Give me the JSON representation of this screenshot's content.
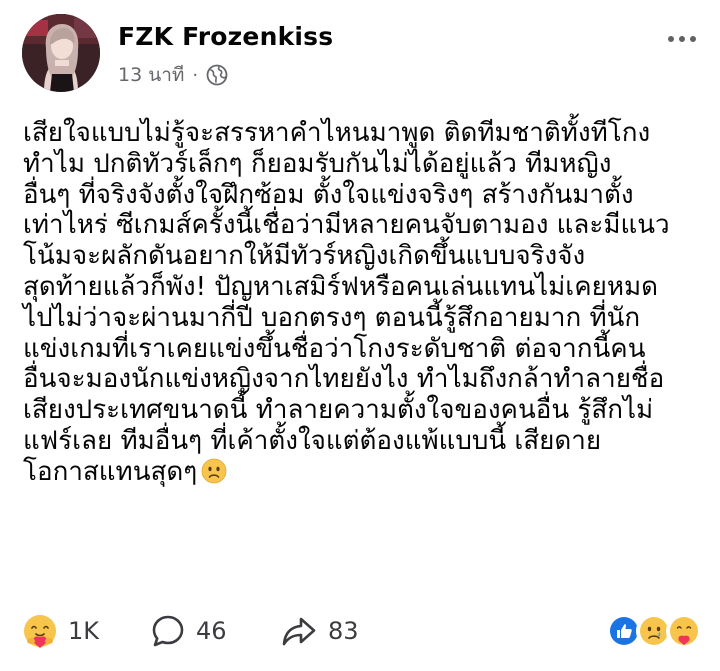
{
  "author": {
    "name": "FZK Frozenkiss",
    "time": "13 นาที",
    "separator": "·",
    "audience_icon": "globe-icon"
  },
  "post": {
    "lines": [
      "เสียใจแบบไม่รู้จะสรรหาคำไหนมาพูด ติดทีมชาติทั้งทีโกง",
      "ทำไม ปกติทัวร์เล็กๆ ก็ยอมรับกันไม่ได้อยู่แล้ว ทีมหญิง",
      "อื่นๆ ที่จริงจังตั้งใจฝึกซ้อม ตั้งใจแข่งจริงๆ สร้างกันมาตั้ง",
      "เท่าไหร่ ซีเกมส์ครั้งนี้เชื่อว่ามีหลายคนจับตามอง และมีแนว",
      "โน้มจะผลักดันอยากให้มีทัวร์หญิงเกิดขึ้นแบบจริงจัง",
      "สุดท้ายแล้วก็พัง! ปัญหาเสมิร์ฟหรือคนเล่นแทนไม่เคยหมด",
      "ไปไม่ว่าจะผ่านมากี่ปี บอกตรงๆ ตอนนี้รู้สึกอายมาก ที่นัก",
      "แข่งเกมที่เราเคยแข่งขึ้นชื่อว่าโกงระดับชาติ ต่อจากนี้คน",
      "อื่นจะมองนักแข่งหญิงจากไทยยังไง ทำไมถึงกล้าทำลายชื่อ",
      "เสียงประเทศขนาดนี้ ทำลายความตั้งใจของคนอื่น รู้สึกไม่",
      "แฟร์เลย ทีมอื่นๆ ที่เค้าตั้งใจแต่ต้องแพ้แบบนี้ เสียดาย",
      "โอกาสแทนสุดๆ"
    ],
    "trailing_emoji": "sad-face-icon"
  },
  "footer": {
    "reaction_count": "1K",
    "comment_count": "46",
    "share_count": "83",
    "reaction_icons": [
      "like-icon",
      "sad-icon",
      "care-icon"
    ]
  },
  "colors": {
    "text": "#050505",
    "secondary": "#65676b",
    "like_blue": "#1b74e4",
    "emoji_yellow": "#f7c54b",
    "care_red": "#f0355b"
  }
}
